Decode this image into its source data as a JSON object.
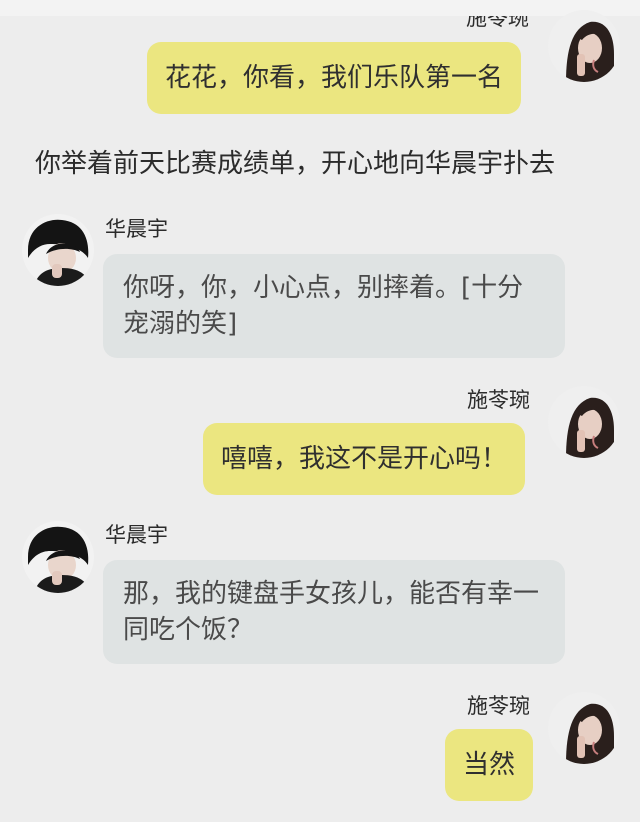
{
  "messages": [
    {
      "sender": "施苓琬",
      "text": "花花，你看，我们乐队第一名"
    },
    {
      "narration": "你举着前天比赛成绩单，开心地向华晨宇扑去"
    },
    {
      "sender": "华晨宇",
      "text": "你呀，你，小心点，别摔着。[十分宠溺的笑]"
    },
    {
      "sender": "施苓琬",
      "text": "嘻嘻，我这不是开心吗！"
    },
    {
      "sender": "华晨宇",
      "text": "那，我的键盘手女孩儿，能否有幸一同吃个饭？"
    },
    {
      "sender": "施苓琬",
      "text": "当然"
    }
  ],
  "colors": {
    "background": "#ededed",
    "right_bubble": "#ebe680",
    "left_bubble": "#dfe3e3"
  },
  "icons": {
    "left_avatar": "avatar-boy",
    "right_avatar": "avatar-girl"
  }
}
